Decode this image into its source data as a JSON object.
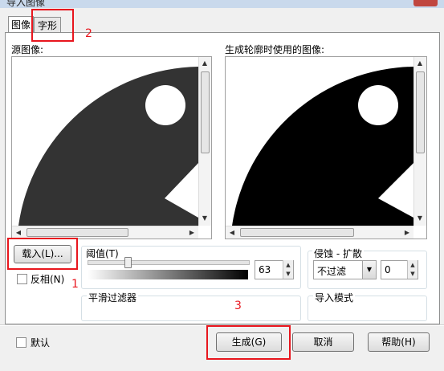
{
  "window": {
    "title": "导入图像"
  },
  "tabs": [
    {
      "label": "图像"
    },
    {
      "label": "字形"
    }
  ],
  "source_panel": {
    "label": "源图像:"
  },
  "preview_panel": {
    "label": "生成轮廓时使用的图像:"
  },
  "load_button": {
    "label": "载入(L)..."
  },
  "invert_checkbox": {
    "label": "反相(N)",
    "checked": false
  },
  "threshold": {
    "label": "阈值(T)",
    "value": "63",
    "level_fraction": 0.25
  },
  "erode_dilate": {
    "label": "侵蚀 - 扩散",
    "filter_value": "不过滤",
    "amount_value": "0"
  },
  "smooth_filter": {
    "label": "平滑过滤器"
  },
  "import_mode": {
    "label": "导入模式"
  },
  "default_checkbox": {
    "label": "默认",
    "checked": false
  },
  "footer_buttons": {
    "generate": "生成(G)",
    "cancel": "取消",
    "help": "帮助(H)"
  },
  "annotations": {
    "n1": "1",
    "n2": "2",
    "n3": "3"
  },
  "colors": {
    "annotation_red": "#e8161e",
    "source_shape": "#333333",
    "preview_shape": "#000000"
  },
  "icons": {
    "scroll_up": "▲",
    "scroll_down": "▼",
    "scroll_left": "◀",
    "scroll_right": "▶",
    "dropdown": "▼"
  }
}
